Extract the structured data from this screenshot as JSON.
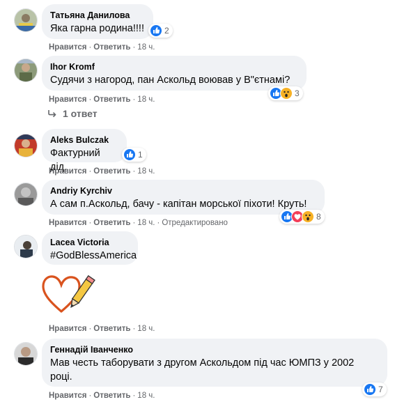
{
  "comments": [
    {
      "author": "Татьяна Данилова",
      "text": "Яка гарна родина!!!!",
      "like": "Нравится",
      "reply": "Ответить",
      "time": "18 ч.",
      "reactions": "2"
    },
    {
      "author": "Ihor Kromf",
      "text": "Судячи з нагород, пан Аскольд воював у В\"єтнамі?",
      "like": "Нравится",
      "reply": "Ответить",
      "time": "18 ч.",
      "reactions": "3"
    },
    {
      "author": "Aleks Bulczak",
      "text": "Фактурний дід.",
      "like": "Нравится",
      "reply": "Ответить",
      "time": "18 ч.",
      "reactions": "1"
    },
    {
      "author": "Andriy Kyrchiv",
      "text": "А сам п.Аскольд, бачу - капітан морської піхоти! Круть!",
      "like": "Нравится",
      "reply": "Ответить",
      "time": "18 ч.",
      "edited": "Отредактировано",
      "reactions": "8"
    },
    {
      "author": "Lacea Victoria",
      "text": "#GodBlessAmerica",
      "like": "Нравится",
      "reply": "Ответить",
      "time": "18 ч."
    },
    {
      "author": "Геннадій Іванченко",
      "text_line1": "Мав честь таборувати з другом Аскольдом під час ЮМПЗ у 2002",
      "text_line2": "році.",
      "like": "Нравится",
      "reply": "Ответить",
      "time": "18 ч.",
      "reactions": "7"
    }
  ],
  "replies_toggle": "1 ответ",
  "colors": {
    "bubble": "#f0f2f5",
    "meta": "#65676b",
    "like_blue": "#1877f2",
    "love_red": "#f33e58",
    "wow_yellow": "#f7b125",
    "sticker_heart": "#d9531e"
  }
}
